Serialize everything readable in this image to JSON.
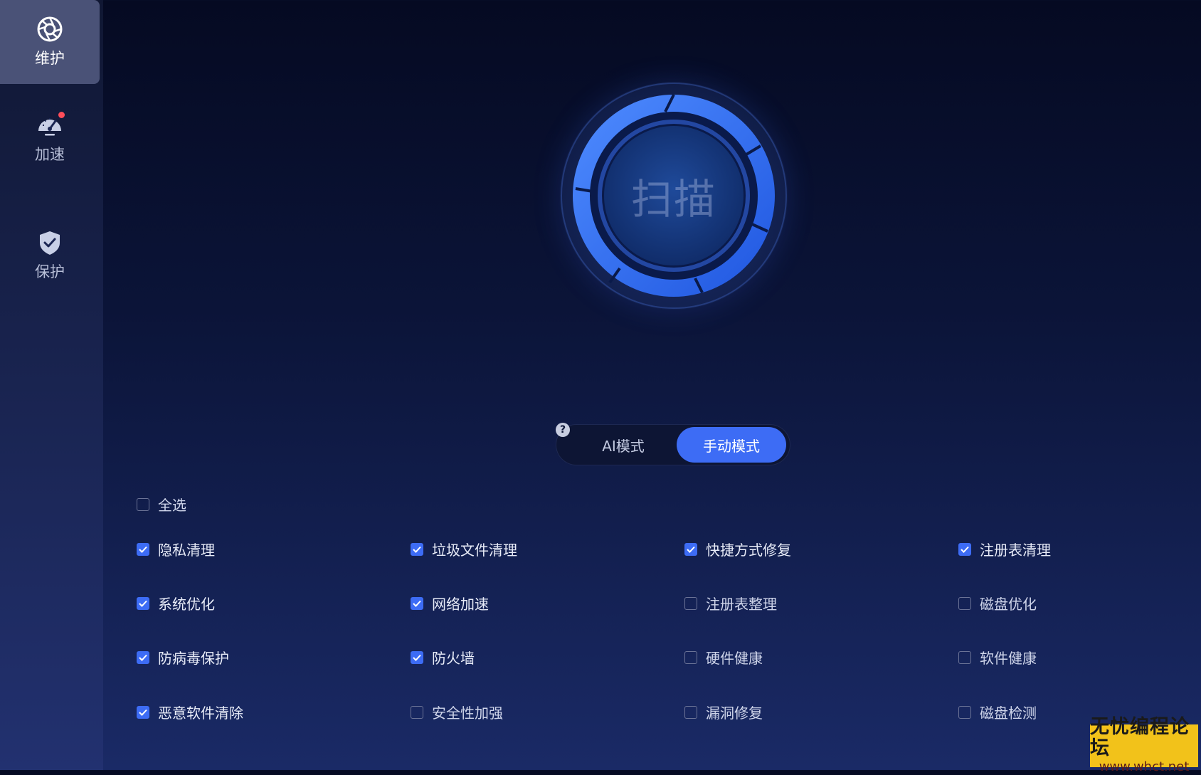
{
  "sidebar": {
    "items": [
      {
        "label": "维护",
        "icon": "aperture-icon",
        "active": true
      },
      {
        "label": "加速",
        "icon": "speedometer-icon",
        "active": false,
        "notification": true
      },
      {
        "label": "保护",
        "icon": "shield-check-icon",
        "active": false
      }
    ]
  },
  "scan": {
    "label": "扫描"
  },
  "mode": {
    "help": "?",
    "ai_label": "AI模式",
    "manual_label": "手动模式",
    "selected": "manual"
  },
  "options": {
    "select_all": {
      "label": "全选",
      "checked": false
    },
    "items": [
      {
        "label": "隐私清理",
        "checked": true
      },
      {
        "label": "垃圾文件清理",
        "checked": true
      },
      {
        "label": "快捷方式修复",
        "checked": true
      },
      {
        "label": "注册表清理",
        "checked": true
      },
      {
        "label": "系统优化",
        "checked": true
      },
      {
        "label": "网络加速",
        "checked": true
      },
      {
        "label": "注册表整理",
        "checked": false
      },
      {
        "label": "磁盘优化",
        "checked": false
      },
      {
        "label": "防病毒保护",
        "checked": true
      },
      {
        "label": "防火墙",
        "checked": true
      },
      {
        "label": "硬件健康",
        "checked": false
      },
      {
        "label": "软件健康",
        "checked": false
      },
      {
        "label": "恶意软件清除",
        "checked": true
      },
      {
        "label": "安全性加强",
        "checked": false
      },
      {
        "label": "漏洞修复",
        "checked": false
      },
      {
        "label": "磁盘检测",
        "checked": false
      }
    ]
  },
  "watermark": {
    "line1": "无忧编程论坛",
    "line2": "www.whct.net"
  },
  "colors": {
    "accent": "#3d6cf5",
    "alert": "#ff4d5a",
    "sidebar_active": "#4a5277"
  }
}
